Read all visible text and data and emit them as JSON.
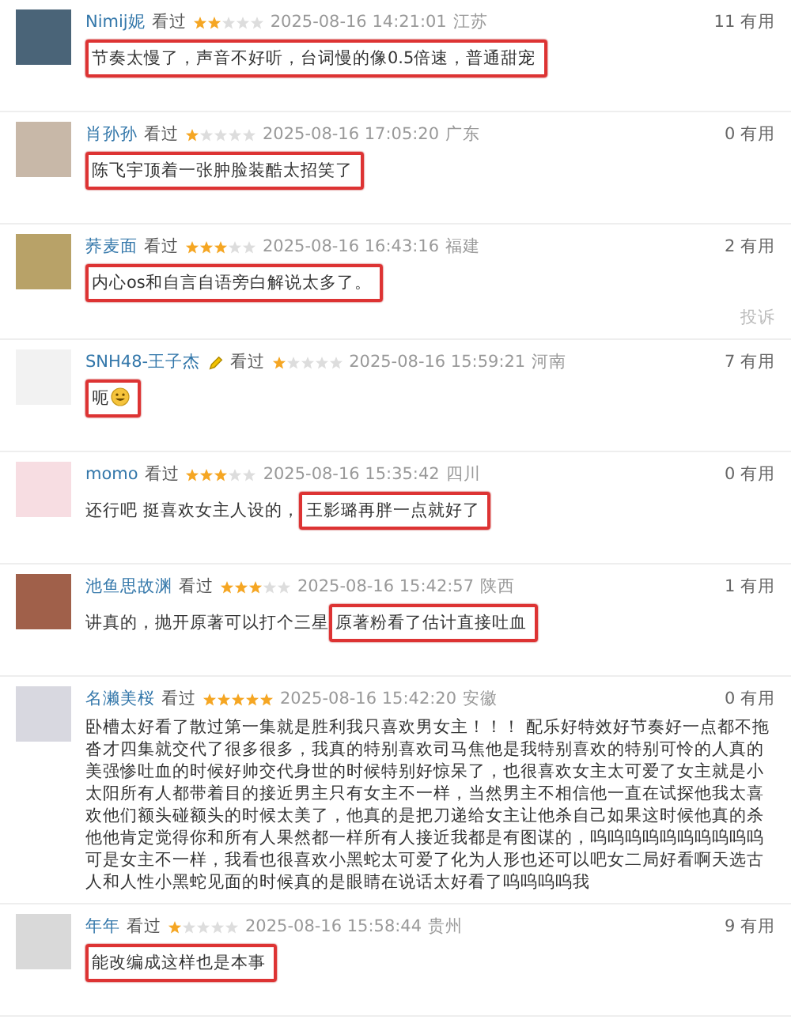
{
  "comments": [
    {
      "user": "Nimij妮",
      "badge": false,
      "status": "看过",
      "stars": 2,
      "time": "2025-08-16 14:21:01",
      "location": "江苏",
      "helpful": "11 有用",
      "emoji": false,
      "segments": [
        {
          "text": "节奏太慢了，声音不好听，台词慢的像0.5倍速，普通甜宠",
          "highlighted": true
        }
      ]
    },
    {
      "user": "肖孙孙",
      "badge": false,
      "status": "看过",
      "stars": 1,
      "time": "2025-08-16 17:05:20",
      "location": "广东",
      "helpful": "0 有用",
      "emoji": false,
      "segments": [
        {
          "text": "陈飞宇顶着一张肿脸装酷太招笑了",
          "highlighted": true
        }
      ]
    },
    {
      "user": "荞麦面",
      "badge": false,
      "status": "看过",
      "stars": 3,
      "time": "2025-08-16 16:43:16",
      "location": "福建",
      "helpful": "2 有用",
      "report": "投诉",
      "emoji": false,
      "segments": [
        {
          "text": "内心os和自言自语旁白解说太多了。",
          "highlighted": true
        }
      ]
    },
    {
      "user": "SNH48-王子杰",
      "badge": true,
      "status": "看过",
      "stars": 1,
      "time": "2025-08-16 15:59:21",
      "location": "河南",
      "helpful": "7 有用",
      "emoji": true,
      "segments": [
        {
          "text": "呃",
          "highlighted": true
        }
      ]
    },
    {
      "user": "momo",
      "badge": false,
      "status": "看过",
      "stars": 3,
      "time": "2025-08-16 15:35:42",
      "location": "四川",
      "helpful": "0 有用",
      "emoji": false,
      "segments": [
        {
          "text": "还行吧 挺喜欢女主人设的，",
          "highlighted": false
        },
        {
          "text": "王影璐再胖一点就好了",
          "highlighted": true
        }
      ]
    },
    {
      "user": "池鱼思故渊",
      "badge": false,
      "status": "看过",
      "stars": 3,
      "time": "2025-08-16 15:42:57",
      "location": "陕西",
      "helpful": "1 有用",
      "emoji": false,
      "segments": [
        {
          "text": "讲真的，抛开原著可以打个三星",
          "highlighted": false
        },
        {
          "text": "原著粉看了估计直接吐血",
          "highlighted": true
        }
      ]
    },
    {
      "user": "名濑美桜",
      "badge": false,
      "status": "看过",
      "stars": 5,
      "time": "2025-08-16 15:42:20",
      "location": "安徽",
      "helpful": "0 有用",
      "emoji": false,
      "segments": [
        {
          "text": "卧槽太好看了散过第一集就是胜利我只喜欢男女主！！！ 配乐好特效好节奏好一点都不拖沓才四集就交代了很多很多，我真的特别喜欢司马焦他是我特别喜欢的特别可怜的人真的美强惨吐血的时候好帅交代身世的时候特别好惊呆了，也很喜欢女主太可爱了女主就是小太阳所有人都带着目的接近男主只有女主不一样，当然男主不相信他一直在试探他我太喜欢他们额头碰额头的时候太美了，他真的是把刀递给女主让他杀自己如果这时候他真的杀他他肯定觉得你和所有人果然都一样所有人接近我都是有图谋的，呜呜呜呜呜呜呜呜呜呜可是女主不一样，我看也很喜欢小黑蛇太可爱了化为人形也还可以吧女二局好看啊天选古人和人性小黑蛇见面的时候真的是眼睛在说话太好看了呜呜呜呜我",
          "highlighted": false
        }
      ]
    },
    {
      "user": "年年",
      "badge": false,
      "status": "看过",
      "stars": 1,
      "time": "2025-08-16 15:58:44",
      "location": "贵州",
      "helpful": "9 有用",
      "emoji": false,
      "segments": [
        {
          "text": "能改编成这样也是本事",
          "highlighted": true
        }
      ]
    }
  ]
}
